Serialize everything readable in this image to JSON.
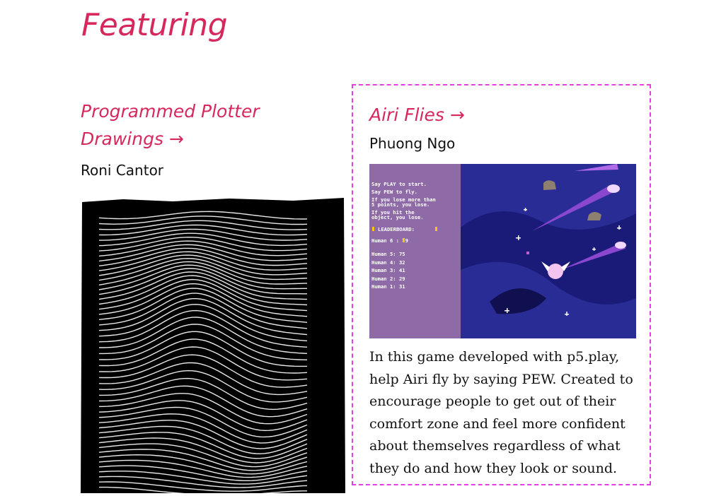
{
  "section": {
    "heading": "Featuring"
  },
  "cards": [
    {
      "title": "Programmed Plotter Drawings →",
      "author": "Roni Cantor"
    },
    {
      "title": "Airi Flies →",
      "author": "Phuong Ngo",
      "game_screen": {
        "instructions": [
          "Say PLAY to start.",
          "Say PEW to fly.",
          "If you lose more than",
          "5 points, you lose.",
          "If you hit the",
          "object, you lose."
        ],
        "leaderboard_label": "LEADERBOARD:",
        "current_score": "Human 6  : 79",
        "scores": [
          "Human 5: 75",
          "Human 4: 32",
          "Human 3: 41",
          "Human 2: 29",
          "Human 1: 31"
        ]
      },
      "description": "In this game developed with p5.play, help Airi fly by saying PEW. Created to encourage people to get out of their comfort zone and feel more confident about themselves regardless of what they do and how they look or sound."
    }
  ],
  "colors": {
    "accent": "#d6285d",
    "focus_outline": "#e43fe0",
    "game_panel": "#8e6aa6",
    "game_sky": "#1a1a78"
  }
}
